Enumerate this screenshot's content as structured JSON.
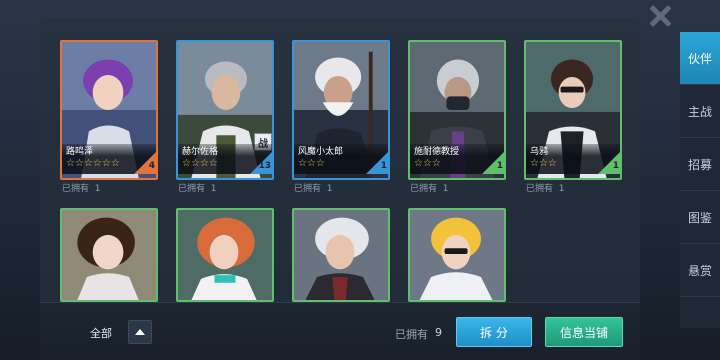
{
  "side_tabs": [
    {
      "label": "伙伴",
      "active": true
    },
    {
      "label": "主战",
      "active": false
    },
    {
      "label": "招募",
      "active": false
    },
    {
      "label": "图鉴",
      "active": false
    },
    {
      "label": "悬赏",
      "active": false
    }
  ],
  "cards_row1": [
    {
      "name": "路鸣泽",
      "stars": "☆☆☆☆☆☆",
      "level": "4",
      "owned_label": "已拥有",
      "owned_count": "1",
      "border": "#e0743c",
      "corner": "#e0743c"
    },
    {
      "name": "赫尔佐格",
      "stars": "☆☆☆☆",
      "level": "13",
      "owned_label": "已拥有",
      "owned_count": "1",
      "border": "#3a95d8",
      "corner": "#3a95d8",
      "badge": "战"
    },
    {
      "name": "风魔小太郎",
      "stars": "☆☆☆",
      "level": "1",
      "owned_label": "已拥有",
      "owned_count": "1",
      "border": "#3a95d8",
      "corner": "#3a95d8"
    },
    {
      "name": "施耐德教授",
      "stars": "☆☆☆",
      "level": "1",
      "owned_label": "已拥有",
      "owned_count": "1",
      "border": "#5fbf6a",
      "corner": "#5fbf6a"
    },
    {
      "name": "乌鸦",
      "stars": "☆☆☆",
      "level": "1",
      "owned_label": "已拥有",
      "owned_count": "1",
      "border": "#5fbf6a",
      "corner": "#5fbf6a"
    }
  ],
  "cards_row2": [
    {
      "border": "#5fbf6a"
    },
    {
      "border": "#5fbf6a"
    },
    {
      "border": "#5fbf6a"
    },
    {
      "border": "#5fbf6a"
    }
  ],
  "bottom": {
    "filter_label": "全部",
    "owned_total_label": "已拥有",
    "owned_total_value": "9",
    "split_button": "拆 分",
    "shop_button": "信息当铺"
  },
  "icons": {
    "close": "close-icon",
    "filter_toggle": "chevron-up-icon"
  }
}
